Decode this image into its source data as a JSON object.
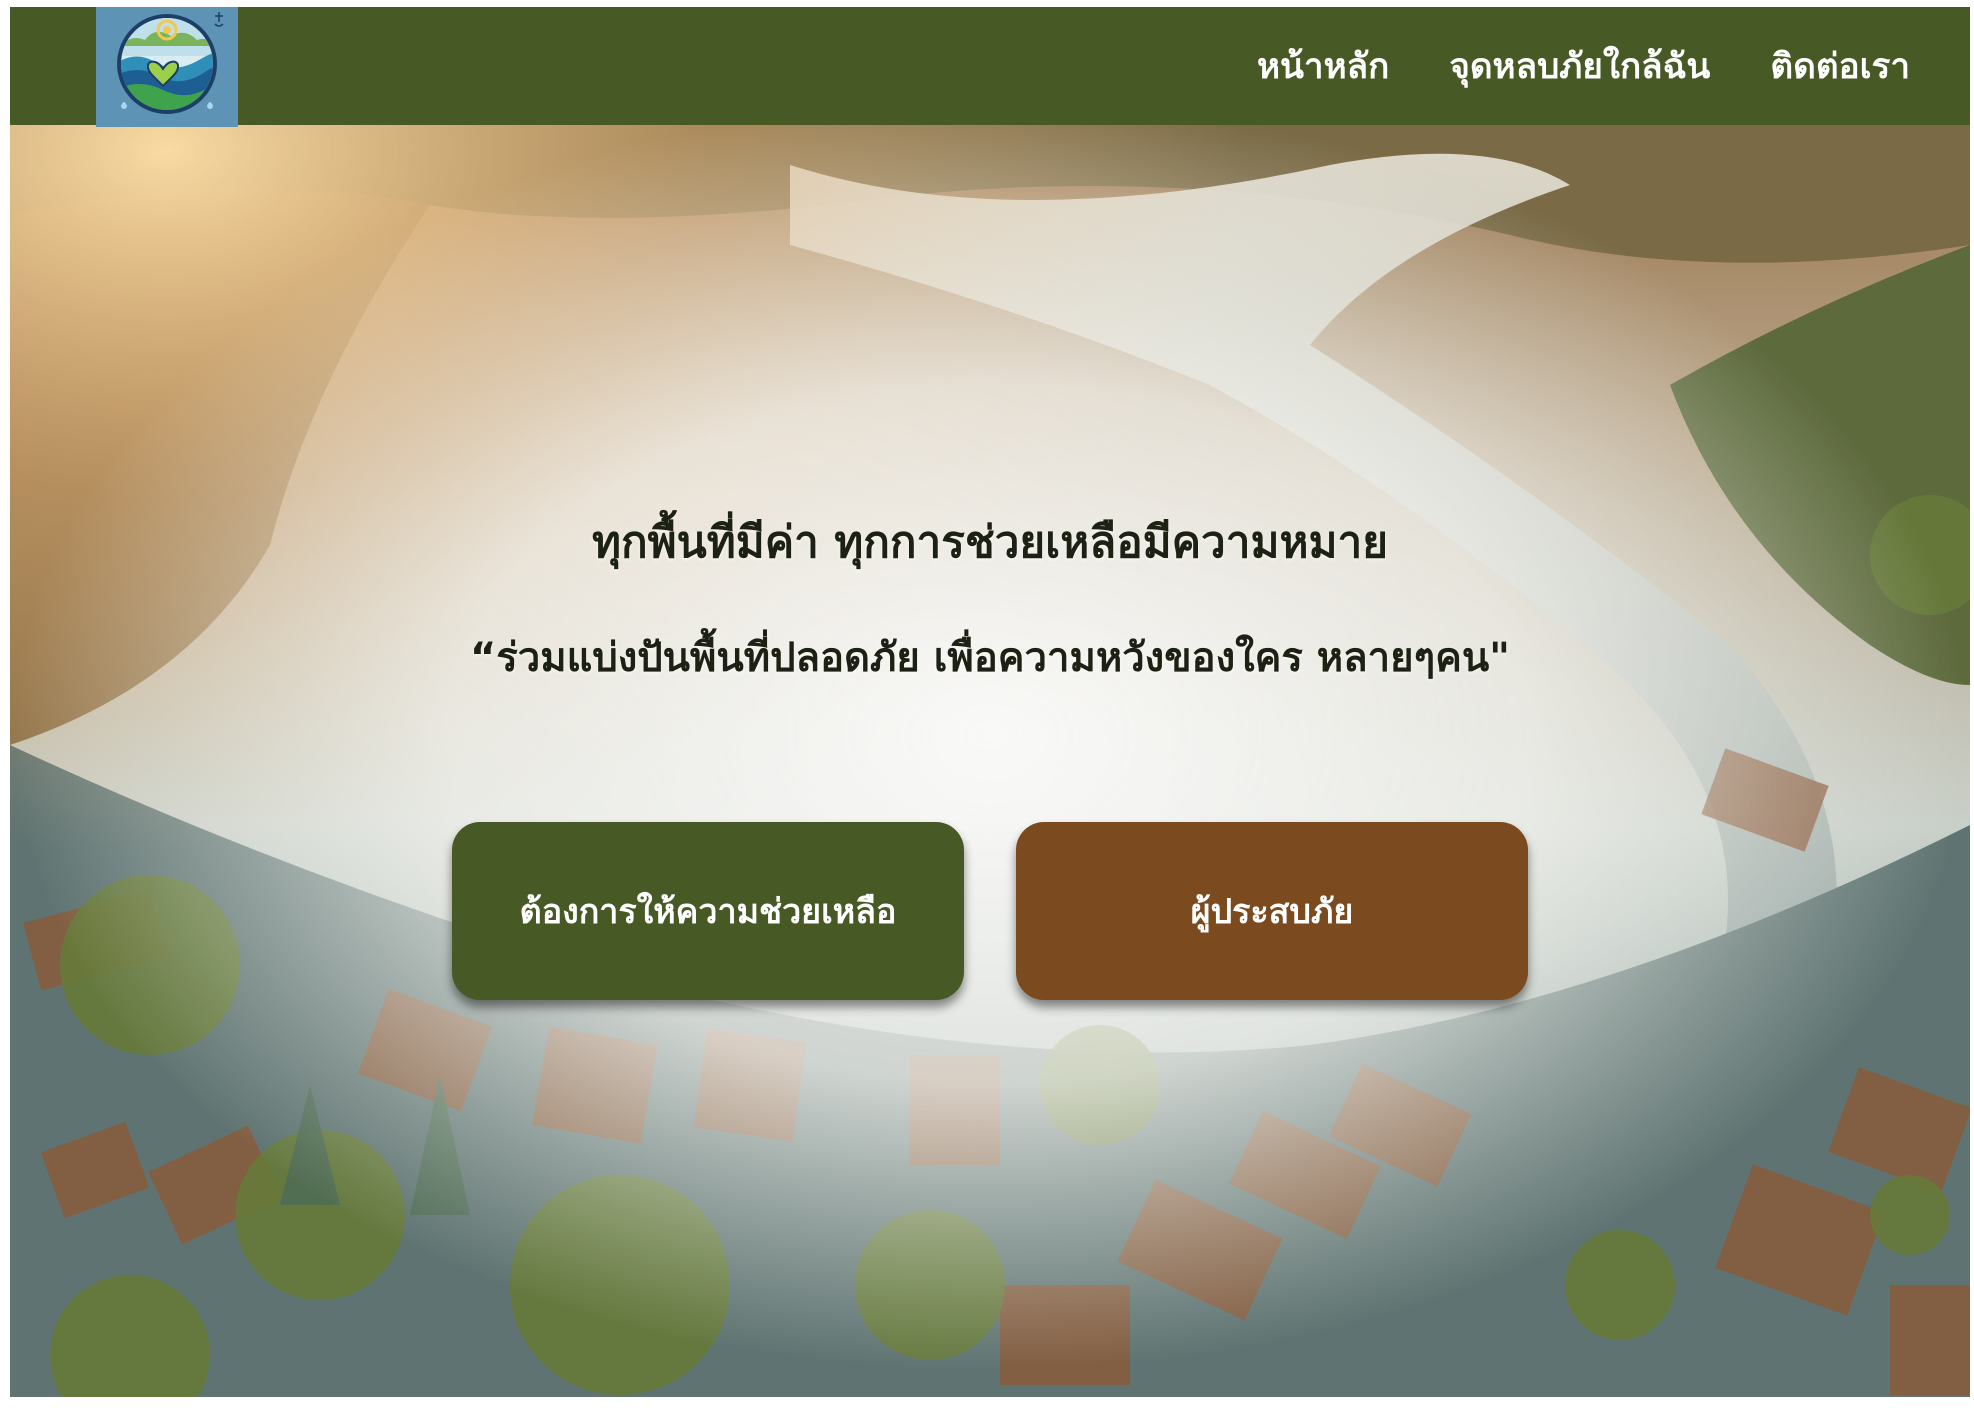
{
  "navbar": {
    "logo_alt": "Flood relief logo",
    "links": [
      {
        "label": "หน้าหลัก"
      },
      {
        "label": "จุดหลบภัยใกล้ฉัน"
      },
      {
        "label": "ติดต่อเรา"
      }
    ]
  },
  "hero": {
    "title": "ทุกพื้นที่มีค่า ทุกการช่วยเหลือมีความหมาย",
    "subtitle": "“ร่วมแบ่งปันพื้นที่ปลอดภัย เพื่อความหวังของใคร หลายๆคน\"",
    "background": "aerial-flooded-town-photo",
    "buttons": {
      "help_label": "ต้องการให้ความช่วยเหลือ",
      "victim_label": "ผู้ประสบภัย"
    }
  },
  "colors": {
    "navbar_bg": "#475a26",
    "help_button": "#475a26",
    "victim_button": "#7b4a1f",
    "logo_bg": "#5d93b4"
  }
}
